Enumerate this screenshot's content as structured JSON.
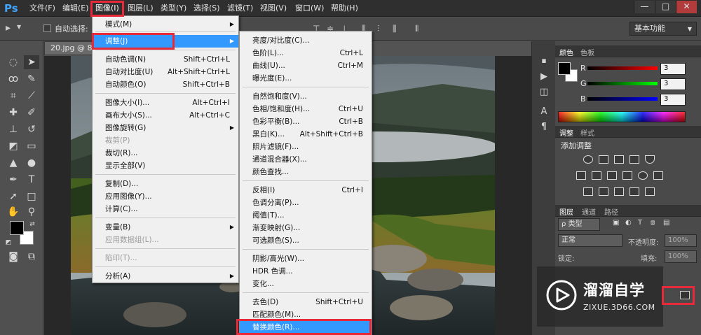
{
  "app_logo": "Ps",
  "menubar": {
    "items": [
      "文件(F)",
      "编辑(E)",
      "图像(I)",
      "图层(L)",
      "类型(Y)",
      "选择(S)",
      "滤镜(T)",
      "视图(V)",
      "窗口(W)",
      "帮助(H)"
    ],
    "active_index": 2
  },
  "window_controls": {
    "minimize": "—",
    "restore": "□",
    "close": "✕"
  },
  "options_bar": {
    "auto_select_label": "自动选择:",
    "workspace": "基本功能"
  },
  "document_tab": "20.jpg @ 87",
  "image_menu": {
    "items": [
      {
        "label": "模式(M)",
        "shortcut": "",
        "submenu": true,
        "disabled": false
      },
      {
        "label": "调整(J)",
        "shortcut": "",
        "submenu": true,
        "disabled": false,
        "highlighted": true
      },
      {
        "label": "自动色调(N)",
        "shortcut": "Shift+Ctrl+L",
        "submenu": false,
        "disabled": false
      },
      {
        "label": "自动对比度(U)",
        "shortcut": "Alt+Shift+Ctrl+L",
        "submenu": false,
        "disabled": false
      },
      {
        "label": "自动颜色(O)",
        "shortcut": "Shift+Ctrl+B",
        "submenu": false,
        "disabled": false
      },
      {
        "label": "图像大小(I)...",
        "shortcut": "Alt+Ctrl+I",
        "submenu": false,
        "disabled": false
      },
      {
        "label": "画布大小(S)...",
        "shortcut": "Alt+Ctrl+C",
        "submenu": false,
        "disabled": false
      },
      {
        "label": "图像旋转(G)",
        "shortcut": "",
        "submenu": true,
        "disabled": false
      },
      {
        "label": "裁剪(P)",
        "shortcut": "",
        "submenu": false,
        "disabled": true
      },
      {
        "label": "裁切(R)...",
        "shortcut": "",
        "submenu": false,
        "disabled": false
      },
      {
        "label": "显示全部(V)",
        "shortcut": "",
        "submenu": false,
        "disabled": false
      },
      {
        "label": "复制(D)...",
        "shortcut": "",
        "submenu": false,
        "disabled": false
      },
      {
        "label": "应用图像(Y)...",
        "shortcut": "",
        "submenu": false,
        "disabled": false
      },
      {
        "label": "计算(C)...",
        "shortcut": "",
        "submenu": false,
        "disabled": false
      },
      {
        "label": "变量(B)",
        "shortcut": "",
        "submenu": true,
        "disabled": false
      },
      {
        "label": "应用数据组(L)...",
        "shortcut": "",
        "submenu": false,
        "disabled": true
      },
      {
        "label": "陷印(T)...",
        "shortcut": "",
        "submenu": false,
        "disabled": true
      },
      {
        "label": "分析(A)",
        "shortcut": "",
        "submenu": true,
        "disabled": false
      }
    ]
  },
  "adjust_menu": {
    "items": [
      {
        "label": "亮度/对比度(C)...",
        "shortcut": ""
      },
      {
        "label": "色阶(L)...",
        "shortcut": "Ctrl+L"
      },
      {
        "label": "曲线(U)...",
        "shortcut": "Ctrl+M"
      },
      {
        "label": "曝光度(E)...",
        "shortcut": ""
      },
      {
        "label": "自然饱和度(V)...",
        "shortcut": ""
      },
      {
        "label": "色相/饱和度(H)...",
        "shortcut": "Ctrl+U"
      },
      {
        "label": "色彩平衡(B)...",
        "shortcut": "Ctrl+B"
      },
      {
        "label": "黑白(K)...",
        "shortcut": "Alt+Shift+Ctrl+B"
      },
      {
        "label": "照片滤镜(F)...",
        "shortcut": ""
      },
      {
        "label": "通道混合器(X)...",
        "shortcut": ""
      },
      {
        "label": "颜色查找...",
        "shortcut": ""
      },
      {
        "label": "反相(I)",
        "shortcut": "Ctrl+I"
      },
      {
        "label": "色调分离(P)...",
        "shortcut": ""
      },
      {
        "label": "阈值(T)...",
        "shortcut": ""
      },
      {
        "label": "渐变映射(G)...",
        "shortcut": ""
      },
      {
        "label": "可选颜色(S)...",
        "shortcut": ""
      },
      {
        "label": "阴影/高光(W)...",
        "shortcut": ""
      },
      {
        "label": "HDR 色调...",
        "shortcut": ""
      },
      {
        "label": "变化...",
        "shortcut": ""
      },
      {
        "label": "去色(D)",
        "shortcut": "Shift+Ctrl+U"
      },
      {
        "label": "匹配颜色(M)...",
        "shortcut": ""
      },
      {
        "label": "替换颜色(R)...",
        "shortcut": "",
        "highlighted": true
      }
    ]
  },
  "color_panel": {
    "tabs": [
      "颜色",
      "色板"
    ],
    "r_label": "R",
    "g_label": "G",
    "b_label": "B",
    "r_value": "3",
    "g_value": "3",
    "b_value": "3"
  },
  "adjustments_panel": {
    "tabs": [
      "调整",
      "样式"
    ],
    "title": "添加调整"
  },
  "layers_panel": {
    "tabs": [
      "图层",
      "通道",
      "路径"
    ],
    "filter_label": "ρ 类型",
    "blend_mode": "正常",
    "opacity_label": "不透明度:",
    "opacity_value": "100%",
    "lock_label": "锁定:",
    "fill_label": "填充:",
    "fill_value": "100%"
  },
  "watermark": {
    "title": "溜溜自学",
    "subtitle": "ZIXUE.3D66.COM"
  },
  "colors": {
    "accent": "#3399ff",
    "highlight_box": "#e8293a"
  }
}
